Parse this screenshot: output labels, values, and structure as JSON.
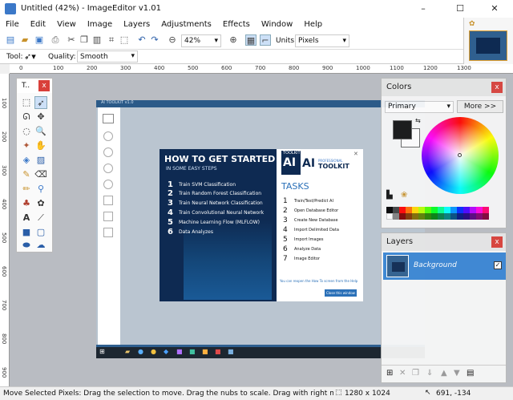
{
  "window": {
    "title": "Untitled (42%) - ImageEditor v1.01",
    "controls": [
      "–",
      "☐",
      "✕"
    ]
  },
  "menu": [
    "File",
    "Edit",
    "View",
    "Image",
    "Layers",
    "Adjustments",
    "Effects",
    "Window",
    "Help"
  ],
  "toolbar": {
    "zoom_value": "42%",
    "units_label": "Units:",
    "units_value": "Pixels"
  },
  "toolbar2": {
    "tool_label": "Tool:",
    "quality_label": "Quality:",
    "quality_value": "Smooth"
  },
  "rulers": {
    "top": [
      "0",
      "100",
      "200",
      "300",
      "400",
      "500",
      "600",
      "700",
      "800",
      "900",
      "1000",
      "1100",
      "1200",
      "1300"
    ],
    "left": [
      "100",
      "200",
      "300",
      "400",
      "500",
      "600",
      "700",
      "800",
      "900"
    ]
  },
  "tools_panel": {
    "title": "T.."
  },
  "colors_panel": {
    "title": "Colors",
    "mode": "Primary",
    "more_button": "More >>"
  },
  "layers_panel": {
    "title": "Layers",
    "layer_name": "Background"
  },
  "inner": {
    "app_title": "AI TOOLKIT v1.0",
    "howto_title": "HOW TO GET STARTED",
    "howto_sub": "IN SOME EASY STEPS",
    "steps": [
      {
        "n": "1",
        "text": "Train SVM Classification"
      },
      {
        "n": "2",
        "text": "Train Random Forest Classification"
      },
      {
        "n": "3",
        "text": "Train Neural Network Classification"
      },
      {
        "n": "4",
        "text": "Train Convolutional Neural Network"
      },
      {
        "n": "5",
        "text": "Machine Learning Flow (MLFLOW)"
      },
      {
        "n": "6",
        "text": "Data Analyzes"
      }
    ],
    "logo_main": "AI",
    "logo_sub1": "TOOLKIT",
    "logo_sub2": "PROFESSIONAL",
    "logo_sub3": "TOOLKIT",
    "tasks_title": "TASKS",
    "tasks": [
      {
        "n": "1",
        "text": "Train/Test/Predict AI"
      },
      {
        "n": "2",
        "text": "Open Database Editor"
      },
      {
        "n": "3",
        "text": "Create New Database"
      },
      {
        "n": "4",
        "text": "Import Delimited Data"
      },
      {
        "n": "5",
        "text": "Import Images"
      },
      {
        "n": "6",
        "text": "Analyze Data"
      },
      {
        "n": "7",
        "text": "Image Editor"
      }
    ],
    "footer_note": "You can reopen the How To screen from the Help",
    "close_button": "Close this window"
  },
  "status": {
    "message": "Move Selected Pixels: Drag the selection to move. Drag the nubs to scale. Drag with right mouse button to ro",
    "dimensions": "1280 x 1024",
    "coords": "691, -134"
  },
  "colors": {
    "accent": "#3b78c8",
    "close_red": "#d9403a",
    "layer_selected": "#3a86d4",
    "dialog_dark": "#0e2a52"
  }
}
